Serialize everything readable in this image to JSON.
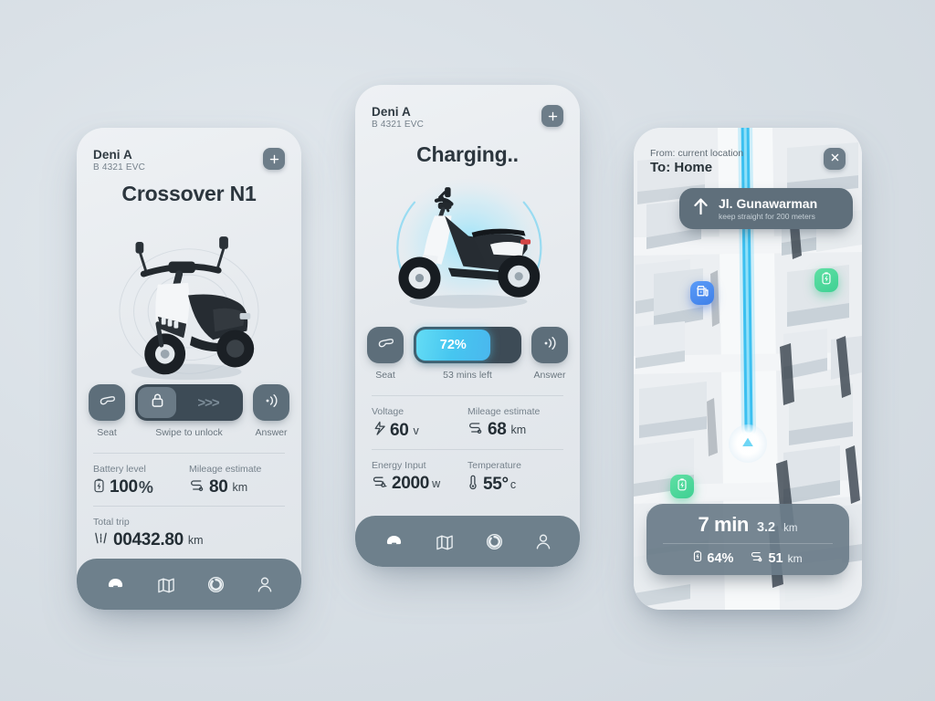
{
  "theme": {
    "accent_cyan": "#4ac6ef",
    "slate": "#5d6e7a",
    "dark_slate": "#3d4b56",
    "nav_bar": "#6e808c",
    "marker_blue": "#4f8ef2",
    "marker_green": "#4dd79b",
    "text_dark": "#242e35",
    "text_muted": "#76828c",
    "page_bg": "#d6dde3"
  },
  "phone1": {
    "owner": {
      "name": "Deni A",
      "plate": "B 4321 EVC"
    },
    "add_button_icon": "plus-icon",
    "title": "Crossover N1",
    "vehicle_image": "scooter-front-three-quarter",
    "controls": {
      "seat": {
        "label": "Seat",
        "icon": "seat-icon"
      },
      "swipe": {
        "label": "Swipe to unlock",
        "icon": "lock-icon",
        "chevrons": ">>>"
      },
      "answer": {
        "label": "Answer",
        "icon": "horn-icon"
      }
    },
    "stats": [
      {
        "label": "Battery level",
        "icon": "battery-charge-icon",
        "value": "100",
        "unit": "%"
      },
      {
        "label": "Mileage estimate",
        "icon": "route-icon",
        "value": "80",
        "unit": "km"
      },
      {
        "label": "Total trip",
        "icon": "road-icon",
        "value": "00432.80",
        "unit": "km"
      }
    ],
    "nav": [
      {
        "name": "scooter",
        "icon": "scooter-icon",
        "active": true
      },
      {
        "name": "map",
        "icon": "map-icon",
        "active": false
      },
      {
        "name": "stats",
        "icon": "donut-chart-icon",
        "active": false
      },
      {
        "name": "profile",
        "icon": "person-icon",
        "active": false
      }
    ]
  },
  "phone2": {
    "owner": {
      "name": "Deni A",
      "plate": "B 4321 EVC"
    },
    "add_button_icon": "plus-icon",
    "title": "Charging..",
    "vehicle_image": "scooter-side-view",
    "controls": {
      "seat": {
        "label": "Seat",
        "icon": "seat-icon"
      },
      "progress": {
        "percent": 72,
        "percent_label": "72%",
        "label": "53 mins left"
      },
      "answer": {
        "label": "Answer",
        "icon": "horn-icon"
      }
    },
    "stats": [
      {
        "label": "Voltage",
        "icon": "bolt-icon",
        "value": "60",
        "unit": "v"
      },
      {
        "label": "Mileage estimate",
        "icon": "route-icon",
        "value": "68",
        "unit": "km"
      },
      {
        "label": "Energy Input",
        "icon": "plug-icon",
        "value": "2000",
        "unit": "w"
      },
      {
        "label": "Temperature",
        "icon": "thermometer-icon",
        "value": "55°",
        "unit": "c"
      }
    ],
    "nav": [
      {
        "name": "scooter",
        "icon": "scooter-icon",
        "active": true
      },
      {
        "name": "map",
        "icon": "map-icon",
        "active": false
      },
      {
        "name": "stats",
        "icon": "donut-chart-icon",
        "active": false
      },
      {
        "name": "profile",
        "icon": "person-icon",
        "active": false
      }
    ]
  },
  "phone3": {
    "route": {
      "from": "From: current location",
      "to": "To: Home"
    },
    "close_button_icon": "close-icon",
    "direction_card": {
      "icon": "arrow-up-icon",
      "street": "Jl. Gunawarman",
      "hint": "keep straight for 200 meters"
    },
    "markers": [
      {
        "id": "shop",
        "icon": "charging-shop-icon",
        "color": "#4f8ef2"
      },
      {
        "id": "battery-1",
        "icon": "battery-charge-icon",
        "color": "#4dd79b"
      },
      {
        "id": "battery-2",
        "icon": "battery-charge-icon",
        "color": "#4dd79b"
      }
    ],
    "position_marker_icon": "navigation-arrow-icon",
    "eta": {
      "time_value": "7 min",
      "distance_value": "3.2",
      "distance_unit": "km",
      "battery_icon": "battery-icon",
      "battery_value": "64%",
      "range_icon": "route-icon",
      "range_value": "51",
      "range_unit": "km"
    }
  }
}
